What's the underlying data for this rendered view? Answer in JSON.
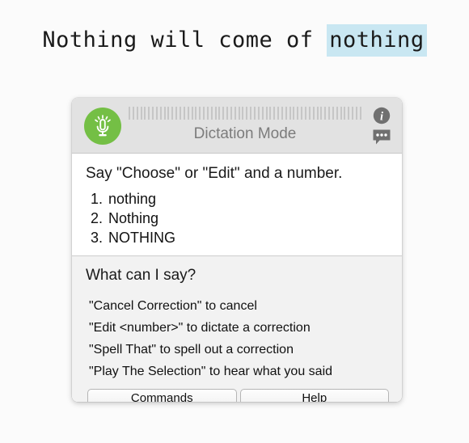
{
  "document": {
    "text_before": "Nothing will come of ",
    "highlighted_text": "nothing",
    "highlight_color": "#c9e7f2"
  },
  "panel": {
    "header": {
      "mic_icon": "microphone-icon",
      "mic_badge_color": "#74bf45",
      "audio_meter_bars": 60,
      "mode_label": "Dictation Mode",
      "stepper_icon": "chevron-updown-icon",
      "info_icon": "info-icon",
      "bubble_icon": "speech-bubble-icon"
    },
    "suggestions": {
      "prompt": "Say \"Choose\" or \"Edit\" and a number.",
      "items": [
        {
          "number": "1.",
          "text": "nothing"
        },
        {
          "number": "2.",
          "text": "Nothing"
        },
        {
          "number": "3.",
          "text": "NOTHING"
        }
      ]
    },
    "help": {
      "title": "What can I say?",
      "commands": [
        "\"Cancel Correction\" to cancel",
        "\"Edit <number>\" to dictate a correction",
        "\"Spell That\" to spell out a correction",
        "\"Play The Selection\" to hear what you said"
      ]
    },
    "footer": {
      "commands_button": "Commands",
      "help_button": "Help"
    }
  }
}
